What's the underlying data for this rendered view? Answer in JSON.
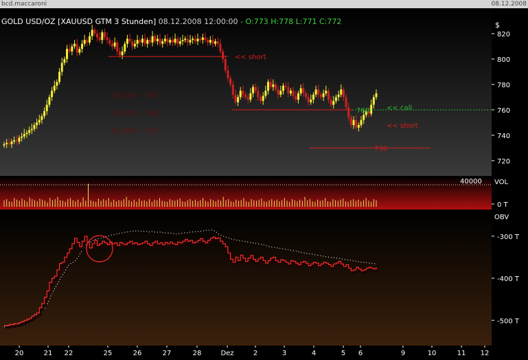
{
  "window": {
    "title": "bcd.maccaroni",
    "date": "08.12.2008"
  },
  "header": {
    "symbol": "GOLD USD/OZ [XAUUSD GTM  3 Stunden]",
    "datetime": "08.12.2008 12:00:00",
    "ohlc": "- O:773 H:778 L:771",
    "close": "C:772",
    "currency": "$"
  },
  "colors": {
    "bull": "#f5ee3a",
    "bear": "#cc2222",
    "levels": "#d81c1c",
    "call": "#2fb82f",
    "obv": "#ff2a2a"
  },
  "chart_data": [
    {
      "type": "candlestick",
      "title": "GOLD USD/OZ [XAUUSD GTM  3 Stunden]",
      "x_tick_labels": [
        "20",
        "21",
        "22",
        "25",
        "26",
        "27",
        "28",
        "Dez",
        "2",
        "3",
        "4",
        "5",
        "6",
        "9",
        "10",
        "11",
        "12"
      ],
      "y_ticks": [
        720,
        740,
        760,
        780,
        800,
        820
      ],
      "ylim": [
        708,
        840
      ],
      "closes": [
        733,
        734,
        733,
        735,
        736,
        735,
        738,
        739,
        741,
        742,
        744,
        745,
        748,
        750,
        752,
        755,
        759,
        764,
        770,
        775,
        779,
        782,
        790,
        797,
        800,
        808,
        806,
        810,
        812,
        805,
        808,
        812,
        815,
        813,
        818,
        823,
        820,
        817,
        815,
        821,
        817,
        815,
        812,
        810,
        813,
        806,
        803,
        806,
        812,
        816,
        814,
        810,
        812,
        815,
        813,
        816,
        812,
        815,
        813,
        818,
        814,
        816,
        812,
        814,
        816,
        813,
        815,
        813,
        816,
        812,
        814,
        815,
        816,
        813,
        815,
        816,
        814,
        816,
        815,
        817,
        815,
        813,
        815,
        812,
        814,
        812,
        806,
        800,
        791,
        785,
        780,
        772,
        766,
        770,
        775,
        772,
        770,
        768,
        773,
        778,
        775,
        770,
        767,
        771,
        775,
        782,
        778,
        780,
        776,
        772,
        775,
        779,
        778,
        773,
        775,
        771,
        768,
        773,
        777,
        773,
        770,
        766,
        768,
        772,
        776,
        772,
        770,
        773,
        775,
        768,
        764,
        767,
        770,
        772,
        776,
        770,
        762,
        754,
        748,
        752,
        746,
        748,
        752,
        756,
        759,
        757,
        764,
        770,
        773
      ],
      "annotations": [
        {
          "price": 802,
          "text": "<< short"
        },
        {
          "price": 760,
          "text": "760"
        },
        {
          "price": 762,
          "text": "<< call"
        },
        {
          "price": 748,
          "text": "<< short"
        },
        {
          "price": 730,
          "text": "730"
        }
      ],
      "fib_labels": [
        "38,20% - 782",
        "50,00% - 768",
        "61,80% - 753"
      ]
    },
    {
      "type": "bar",
      "name": "VOL",
      "y_ticks_labels": [
        "40000",
        "0 T"
      ],
      "ylim": [
        0,
        50000
      ],
      "values": [
        12000,
        14000,
        10000,
        9000,
        16000,
        13000,
        11000,
        15000,
        12000,
        9000,
        17000,
        14000,
        12000,
        10000,
        15000,
        13000,
        11000,
        8000,
        16000,
        12000,
        14000,
        18000,
        12000,
        11000,
        9000,
        14000,
        16000,
        12000,
        10000,
        13000,
        8000,
        17000,
        11000,
        42000,
        12000,
        10000,
        9000,
        15000,
        11000,
        14000,
        12000,
        16000,
        9000,
        13000,
        10000,
        12000,
        11000,
        14000,
        18000,
        12000,
        10000,
        13000,
        9000,
        15000,
        11000,
        12000,
        10000,
        14000,
        9000,
        13000,
        12000,
        16000,
        11000,
        10000,
        9000,
        14000,
        12000,
        11000,
        13000,
        15000,
        10000,
        9000,
        12000,
        14000,
        11000,
        13000,
        10000,
        12000,
        16000,
        11000,
        9000,
        14000,
        12000,
        10000,
        13000,
        11000,
        18000,
        12000,
        14000,
        10000,
        9000,
        13000,
        11000,
        12000,
        16000,
        10000,
        9000,
        14000,
        12000,
        11000,
        13000,
        15000,
        10000,
        9000,
        12000,
        14000,
        11000,
        13000,
        10000,
        12000,
        16000,
        11000,
        9000,
        14000,
        12000,
        10000,
        13000,
        11000,
        18000,
        12000,
        14000,
        10000,
        9000,
        13000,
        11000,
        12000,
        16000,
        10000,
        9000,
        14000,
        12000,
        11000,
        13000,
        15000,
        10000,
        9000,
        12000,
        14000,
        11000,
        13000,
        10000,
        12000,
        16000,
        11000,
        9000,
        14000,
        12000
      ]
    },
    {
      "type": "line",
      "name": "OBV",
      "y_tick_labels": [
        "-300 T",
        "-400 T",
        "-500 T"
      ],
      "ylim": [
        -560,
        -240
      ],
      "series": [
        {
          "values": [
            -515,
            -513,
            -512,
            -510,
            -508,
            -510,
            -506,
            -505,
            -500,
            -502,
            -498,
            -495,
            -490,
            -488,
            -485,
            -482,
            -475,
            -468,
            -455,
            -440,
            -430,
            -420,
            -410,
            -398,
            -390,
            -380,
            -370,
            -365,
            -362,
            -358,
            -350,
            -340,
            -330,
            -322,
            -318,
            -314,
            -310,
            -308,
            -306,
            -305,
            -304,
            -302,
            -300,
            -298,
            -297,
            -296,
            -294,
            -293,
            -292,
            -291,
            -290,
            -289,
            -288,
            -288,
            -287,
            -288,
            -289,
            -288,
            -289,
            -290,
            -289,
            -290,
            -291,
            -290,
            -291,
            -292,
            -293,
            -292,
            -293,
            -294,
            -295,
            -294,
            -293,
            -292,
            -292,
            -291,
            -290,
            -290,
            -289,
            -289,
            -288,
            -287,
            -286,
            -286,
            -285,
            -286,
            -290,
            -295,
            -298,
            -300,
            -302,
            -304,
            -306,
            -308,
            -309,
            -310,
            -311,
            -312,
            -313,
            -314,
            -315,
            -316,
            -317,
            -318,
            -319,
            -320,
            -322,
            -324,
            -325,
            -326,
            -327,
            -328,
            -329,
            -330,
            -331,
            -332,
            -333,
            -334,
            -335,
            -336,
            -338,
            -339,
            -340,
            -341,
            -342,
            -343,
            -344,
            -345,
            -346,
            -347,
            -348,
            -349,
            -350,
            -351,
            -351,
            -352,
            -353,
            -354,
            -355,
            -356,
            -357,
            -358,
            -359,
            -360,
            -361,
            -362,
            -362,
            -363,
            -364,
            -364,
            -365,
            -366
          ]
        },
        {
          "values": [
            -512,
            -512,
            -510,
            -510,
            -508,
            -508,
            -505,
            -503,
            -500,
            -498,
            -495,
            -490,
            -486,
            -482,
            -470,
            -460,
            -445,
            -430,
            -410,
            -400,
            -395,
            -380,
            -365,
            -362,
            -350,
            -340,
            -330,
            -318,
            -305,
            -315,
            -325,
            -312,
            -300,
            -315,
            -328,
            -318,
            -310,
            -322,
            -318,
            -312,
            -316,
            -320,
            -314,
            -318,
            -316,
            -322,
            -315,
            -318,
            -320,
            -316,
            -312,
            -318,
            -316,
            -320,
            -318,
            -316,
            -312,
            -318,
            -322,
            -316,
            -312,
            -318,
            -316,
            -320,
            -315,
            -318,
            -314,
            -318,
            -320,
            -314,
            -316,
            -312,
            -308,
            -312,
            -310,
            -316,
            -314,
            -310,
            -306,
            -312,
            -316,
            -310,
            -305,
            -302,
            -306,
            -304,
            -312,
            -318,
            -325,
            -340,
            -355,
            -362,
            -350,
            -358,
            -345,
            -352,
            -360,
            -352,
            -346,
            -355,
            -360,
            -354,
            -350,
            -358,
            -364,
            -358,
            -352,
            -350,
            -358,
            -362,
            -356,
            -358,
            -362,
            -366,
            -358,
            -360,
            -364,
            -368,
            -362,
            -360,
            -364,
            -370,
            -366,
            -362,
            -364,
            -370,
            -366,
            -362,
            -364,
            -368,
            -372,
            -366,
            -364,
            -360,
            -366,
            -372,
            -368,
            -376,
            -382,
            -380,
            -374,
            -378,
            -382,
            -380,
            -376,
            -374,
            -376,
            -378,
            -374
          ]
        }
      ]
    }
  ]
}
